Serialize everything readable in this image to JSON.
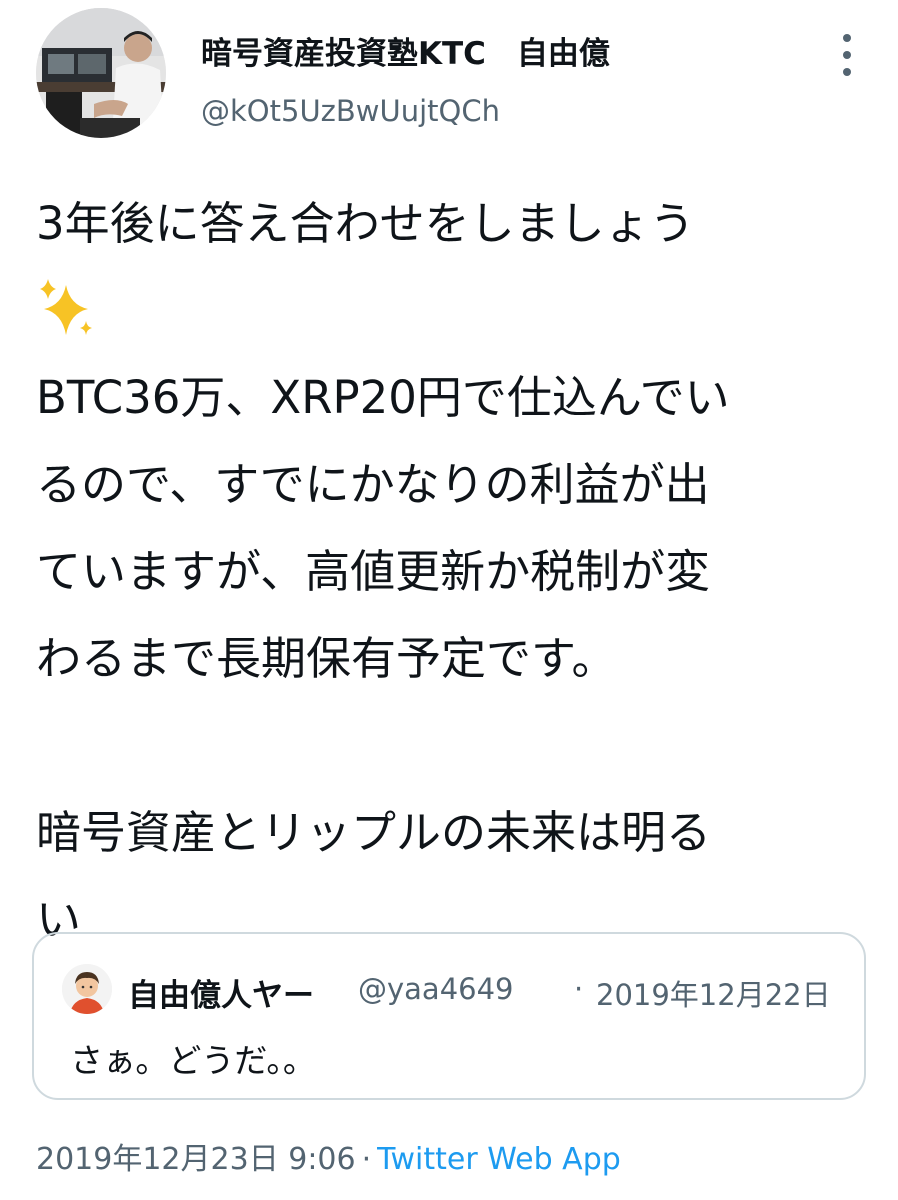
{
  "author": {
    "display_name": "暗号資産投資塾KTC　自由億",
    "handle": "@kOt5UzBwUujtQCh"
  },
  "tweet": {
    "lines": [
      "3年後に答え合わせをしましょう",
      "BTC36万、XRP20円で仕込んでい",
      "るので、すでにかなりの利益が出",
      "ていますが、高値更新か税制が変",
      "わるまで長期保有予定です。",
      "暗号資産とリップルの未来は明る",
      "い"
    ],
    "emoji_icon": "sparkles-icon"
  },
  "quoted_tweet": {
    "display_name": "自由億人ヤー",
    "handle": "@yaa4649",
    "separator": "·",
    "date": "2019年12月22日",
    "text": "さぁ。どうだ。。"
  },
  "footer": {
    "timestamp": "2019年12月23日 9:06",
    "separator": "·",
    "source": "Twitter Web App"
  },
  "colors": {
    "text": "#0f1419",
    "secondary": "#536471",
    "link": "#1d9bf0",
    "border": "#cfd9de",
    "sparkle": "#f7c325"
  }
}
